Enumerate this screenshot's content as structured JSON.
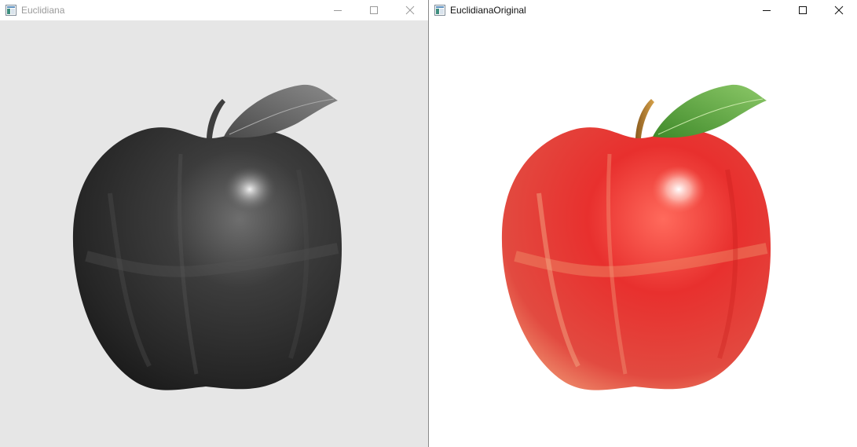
{
  "windows": [
    {
      "title": "Euclidiana",
      "active": false,
      "image": {
        "description": "grayscale apple",
        "mode": "grayscale",
        "background": "#e6e6e6"
      }
    },
    {
      "title": "EuclidianaOriginal",
      "active": true,
      "image": {
        "description": "original color apple",
        "mode": "color",
        "background": "#ffffff"
      }
    }
  ],
  "controls": {
    "minimize_icon": "minimize-icon",
    "maximize_icon": "maximize-icon",
    "close_icon": "close-icon"
  },
  "colors": {
    "inactive_title": "#9a9a9a",
    "active_title": "#111111",
    "apple_red": "#e23a36",
    "leaf_green": "#5aa23a",
    "stem_gold": "#b8862e"
  }
}
